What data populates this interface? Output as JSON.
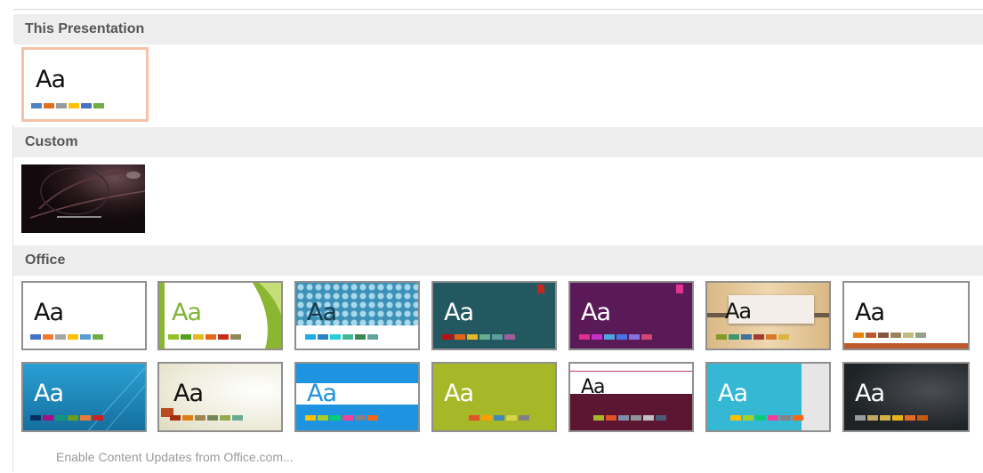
{
  "sections": {
    "this_presentation": "This Presentation",
    "custom": "Custom",
    "office": "Office"
  },
  "theme_preview_text": "Aa",
  "footer_link": "Enable Content Updates from Office.com...",
  "themes": {
    "this_presentation": {
      "colors": [
        "#4f81bd",
        "#e2701f",
        "#9b9b9b",
        "#ffc000",
        "#4472c4",
        "#70ad47"
      ]
    },
    "office_row1": [
      {
        "id": "office-theme",
        "bg": "#ffffff",
        "text": "#111111",
        "colors": [
          "#4472c4",
          "#ed7d31",
          "#a5a5a5",
          "#ffc000",
          "#5b9bd5",
          "#70ad47"
        ]
      },
      {
        "id": "facet",
        "bg": "#ffffff",
        "text": "#7fb536",
        "colors": [
          "#90c226",
          "#54a021",
          "#e6b91e",
          "#e76618",
          "#c42f1a",
          "#918655"
        ]
      },
      {
        "id": "integral",
        "bg": "#3d91b8",
        "text": "#ffffff",
        "colors": [
          "#1cade4",
          "#2683c6",
          "#27ced7",
          "#42ba97",
          "#3e8853",
          "#62a39f"
        ]
      },
      {
        "id": "ion-boardroom",
        "bg": "#22525a",
        "text": "#ffffff",
        "colors": [
          "#b01513",
          "#ea6312",
          "#e6b729",
          "#6aac90",
          "#5f9c9d",
          "#9e5e9b"
        ]
      },
      {
        "id": "ion",
        "bg": "#5a1a57",
        "text": "#ffffff",
        "colors": [
          "#e32d91",
          "#c830cc",
          "#4ea6dc",
          "#4775e7",
          "#8971e1",
          "#d54773"
        ]
      },
      {
        "id": "organic",
        "bg": "#e4c69a",
        "text": "#111111",
        "colors": [
          "#83992a",
          "#3c9770",
          "#44709d",
          "#a23c33",
          "#d97828",
          "#deb340"
        ]
      },
      {
        "id": "retrospect",
        "bg": "#ffffff",
        "text": "#111111",
        "colors": [
          "#e48312",
          "#bd582c",
          "#865640",
          "#9b8357",
          "#c2bc80",
          "#94a088"
        ]
      }
    ],
    "office_row2": [
      {
        "id": "slice",
        "bg": "#1e84b8",
        "text": "#ffffff",
        "colors": [
          "#052f61",
          "#a50e82",
          "#14967c",
          "#6a9e1f",
          "#e87d37",
          "#c62324"
        ]
      },
      {
        "id": "wisp",
        "bg": "#f3f1e3",
        "text": "#111111",
        "colors": [
          "#a53010",
          "#de7e18",
          "#9f8351",
          "#728653",
          "#92aa4c",
          "#6aac91"
        ]
      },
      {
        "id": "banded",
        "bg": "#2196e0",
        "text": "#ffffff",
        "colors": [
          "#ffc000",
          "#a5d028",
          "#08cc78",
          "#f24099",
          "#828288",
          "#f56617"
        ]
      },
      {
        "id": "basis",
        "bg": "#a6b727",
        "text": "#ffffff",
        "colors": [
          "#a6b727",
          "#df5327",
          "#fe9e00",
          "#418ab3",
          "#d7d447",
          "#818183"
        ]
      },
      {
        "id": "berlin",
        "bg": "#5c1632",
        "text": "#111111",
        "colors": [
          "#a6b727",
          "#df5327",
          "#7f8fa9",
          "#5c1632",
          "#8f969b",
          "#4a5b78"
        ]
      },
      {
        "id": "circuit",
        "bg": "#34b8d4",
        "text": "#ffffff",
        "colors": [
          "#ffc000",
          "#a5d028",
          "#08cc78",
          "#f24099",
          "#828288",
          "#f56617"
        ]
      },
      {
        "id": "damask",
        "bg": "#1e2326",
        "text": "#ffffff",
        "colors": [
          "#9b9b9b",
          "#c0a764",
          "#d0b14a",
          "#e8b21a",
          "#e66b24",
          "#c55a11"
        ]
      }
    ]
  }
}
